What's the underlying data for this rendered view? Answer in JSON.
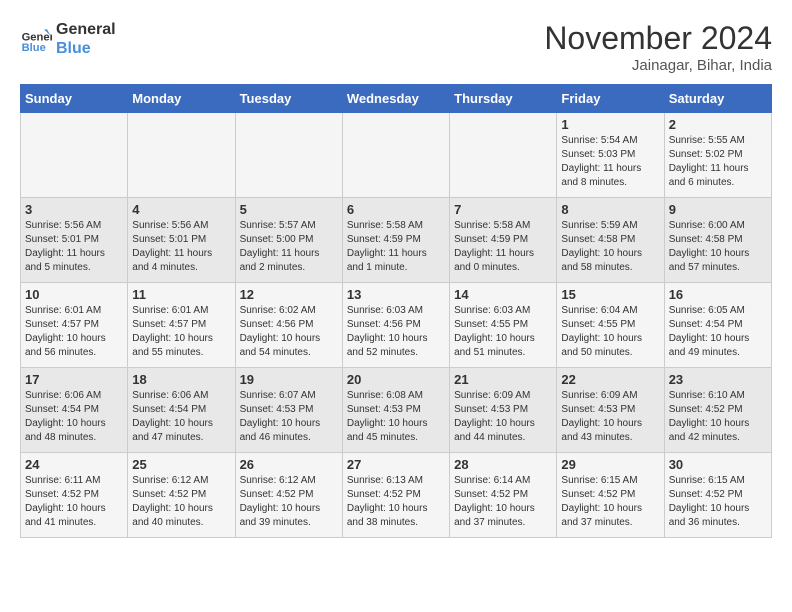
{
  "logo": {
    "line1": "General",
    "line2": "Blue"
  },
  "header": {
    "title": "November 2024",
    "location": "Jainagar, Bihar, India"
  },
  "columns": [
    "Sunday",
    "Monday",
    "Tuesday",
    "Wednesday",
    "Thursday",
    "Friday",
    "Saturday"
  ],
  "weeks": [
    [
      {
        "day": "",
        "info": ""
      },
      {
        "day": "",
        "info": ""
      },
      {
        "day": "",
        "info": ""
      },
      {
        "day": "",
        "info": ""
      },
      {
        "day": "",
        "info": ""
      },
      {
        "day": "1",
        "info": "Sunrise: 5:54 AM\nSunset: 5:03 PM\nDaylight: 11 hours and 8 minutes."
      },
      {
        "day": "2",
        "info": "Sunrise: 5:55 AM\nSunset: 5:02 PM\nDaylight: 11 hours and 6 minutes."
      }
    ],
    [
      {
        "day": "3",
        "info": "Sunrise: 5:56 AM\nSunset: 5:01 PM\nDaylight: 11 hours and 5 minutes."
      },
      {
        "day": "4",
        "info": "Sunrise: 5:56 AM\nSunset: 5:01 PM\nDaylight: 11 hours and 4 minutes."
      },
      {
        "day": "5",
        "info": "Sunrise: 5:57 AM\nSunset: 5:00 PM\nDaylight: 11 hours and 2 minutes."
      },
      {
        "day": "6",
        "info": "Sunrise: 5:58 AM\nSunset: 4:59 PM\nDaylight: 11 hours and 1 minute."
      },
      {
        "day": "7",
        "info": "Sunrise: 5:58 AM\nSunset: 4:59 PM\nDaylight: 11 hours and 0 minutes."
      },
      {
        "day": "8",
        "info": "Sunrise: 5:59 AM\nSunset: 4:58 PM\nDaylight: 10 hours and 58 minutes."
      },
      {
        "day": "9",
        "info": "Sunrise: 6:00 AM\nSunset: 4:58 PM\nDaylight: 10 hours and 57 minutes."
      }
    ],
    [
      {
        "day": "10",
        "info": "Sunrise: 6:01 AM\nSunset: 4:57 PM\nDaylight: 10 hours and 56 minutes."
      },
      {
        "day": "11",
        "info": "Sunrise: 6:01 AM\nSunset: 4:57 PM\nDaylight: 10 hours and 55 minutes."
      },
      {
        "day": "12",
        "info": "Sunrise: 6:02 AM\nSunset: 4:56 PM\nDaylight: 10 hours and 54 minutes."
      },
      {
        "day": "13",
        "info": "Sunrise: 6:03 AM\nSunset: 4:56 PM\nDaylight: 10 hours and 52 minutes."
      },
      {
        "day": "14",
        "info": "Sunrise: 6:03 AM\nSunset: 4:55 PM\nDaylight: 10 hours and 51 minutes."
      },
      {
        "day": "15",
        "info": "Sunrise: 6:04 AM\nSunset: 4:55 PM\nDaylight: 10 hours and 50 minutes."
      },
      {
        "day": "16",
        "info": "Sunrise: 6:05 AM\nSunset: 4:54 PM\nDaylight: 10 hours and 49 minutes."
      }
    ],
    [
      {
        "day": "17",
        "info": "Sunrise: 6:06 AM\nSunset: 4:54 PM\nDaylight: 10 hours and 48 minutes."
      },
      {
        "day": "18",
        "info": "Sunrise: 6:06 AM\nSunset: 4:54 PM\nDaylight: 10 hours and 47 minutes."
      },
      {
        "day": "19",
        "info": "Sunrise: 6:07 AM\nSunset: 4:53 PM\nDaylight: 10 hours and 46 minutes."
      },
      {
        "day": "20",
        "info": "Sunrise: 6:08 AM\nSunset: 4:53 PM\nDaylight: 10 hours and 45 minutes."
      },
      {
        "day": "21",
        "info": "Sunrise: 6:09 AM\nSunset: 4:53 PM\nDaylight: 10 hours and 44 minutes."
      },
      {
        "day": "22",
        "info": "Sunrise: 6:09 AM\nSunset: 4:53 PM\nDaylight: 10 hours and 43 minutes."
      },
      {
        "day": "23",
        "info": "Sunrise: 6:10 AM\nSunset: 4:52 PM\nDaylight: 10 hours and 42 minutes."
      }
    ],
    [
      {
        "day": "24",
        "info": "Sunrise: 6:11 AM\nSunset: 4:52 PM\nDaylight: 10 hours and 41 minutes."
      },
      {
        "day": "25",
        "info": "Sunrise: 6:12 AM\nSunset: 4:52 PM\nDaylight: 10 hours and 40 minutes."
      },
      {
        "day": "26",
        "info": "Sunrise: 6:12 AM\nSunset: 4:52 PM\nDaylight: 10 hours and 39 minutes."
      },
      {
        "day": "27",
        "info": "Sunrise: 6:13 AM\nSunset: 4:52 PM\nDaylight: 10 hours and 38 minutes."
      },
      {
        "day": "28",
        "info": "Sunrise: 6:14 AM\nSunset: 4:52 PM\nDaylight: 10 hours and 37 minutes."
      },
      {
        "day": "29",
        "info": "Sunrise: 6:15 AM\nSunset: 4:52 PM\nDaylight: 10 hours and 37 minutes."
      },
      {
        "day": "30",
        "info": "Sunrise: 6:15 AM\nSunset: 4:52 PM\nDaylight: 10 hours and 36 minutes."
      }
    ]
  ]
}
